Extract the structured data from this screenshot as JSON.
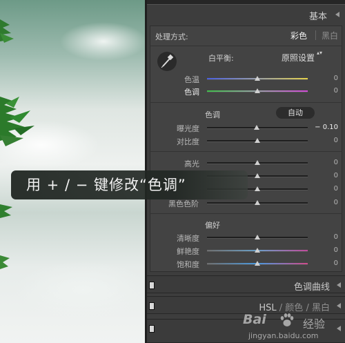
{
  "panel": {
    "title": "基本",
    "treatment_label": "处理方式:",
    "treatment_color": "彩色",
    "treatment_bw": "黑白",
    "white_balance_label": "白平衡:",
    "white_balance_value": "原照设置",
    "white_balance_arrows": "▴▾",
    "sliders": [
      {
        "label": "色温",
        "value": "0",
        "level": 0.5
      },
      {
        "label": "色调",
        "value": "0",
        "level": 0.5
      },
      {
        "label": "曝光度",
        "value": "− 0.10",
        "level": 0.49
      },
      {
        "label": "对比度",
        "value": "0",
        "level": 0.5
      },
      {
        "label": "高光",
        "value": "0",
        "level": 0.5
      },
      {
        "label": "",
        "value": "0",
        "level": 0.5
      },
      {
        "label": "",
        "value": "0",
        "level": 0.5
      },
      {
        "label": "黑色色阶",
        "value": "0",
        "level": 0.5
      },
      {
        "label": "清晰度",
        "value": "0",
        "level": 0.5
      },
      {
        "label": "鲜艳度",
        "value": "0",
        "level": 0.5
      },
      {
        "label": "饱和度",
        "value": "0",
        "level": 0.5
      }
    ],
    "tone_label": "色调",
    "auto_button": "自动",
    "presence_label": "偏好"
  },
  "sections": {
    "tone_curve": "色调曲线",
    "hsl": "HSL",
    "hsl_sep": "/",
    "color": "颜色",
    "bw": "黑白"
  },
  "tooltip": {
    "text": "用 + / − 键修改“色调”"
  },
  "watermark": {
    "brand": "Bai",
    "jingyan": "经验",
    "url": "jingyan.baidu.com"
  },
  "colors": {
    "panel_bg": "#3d3d3d",
    "temp_track_left": "#4a5fe0",
    "temp_track_right": "#e6d24a",
    "tint_track_left": "#3fbf4a",
    "tint_track_right": "#d24ad8"
  },
  "icons": [
    "eyedropper-icon",
    "collapse-triangle-icon",
    "section-toggle-icon",
    "paw-icon"
  ]
}
